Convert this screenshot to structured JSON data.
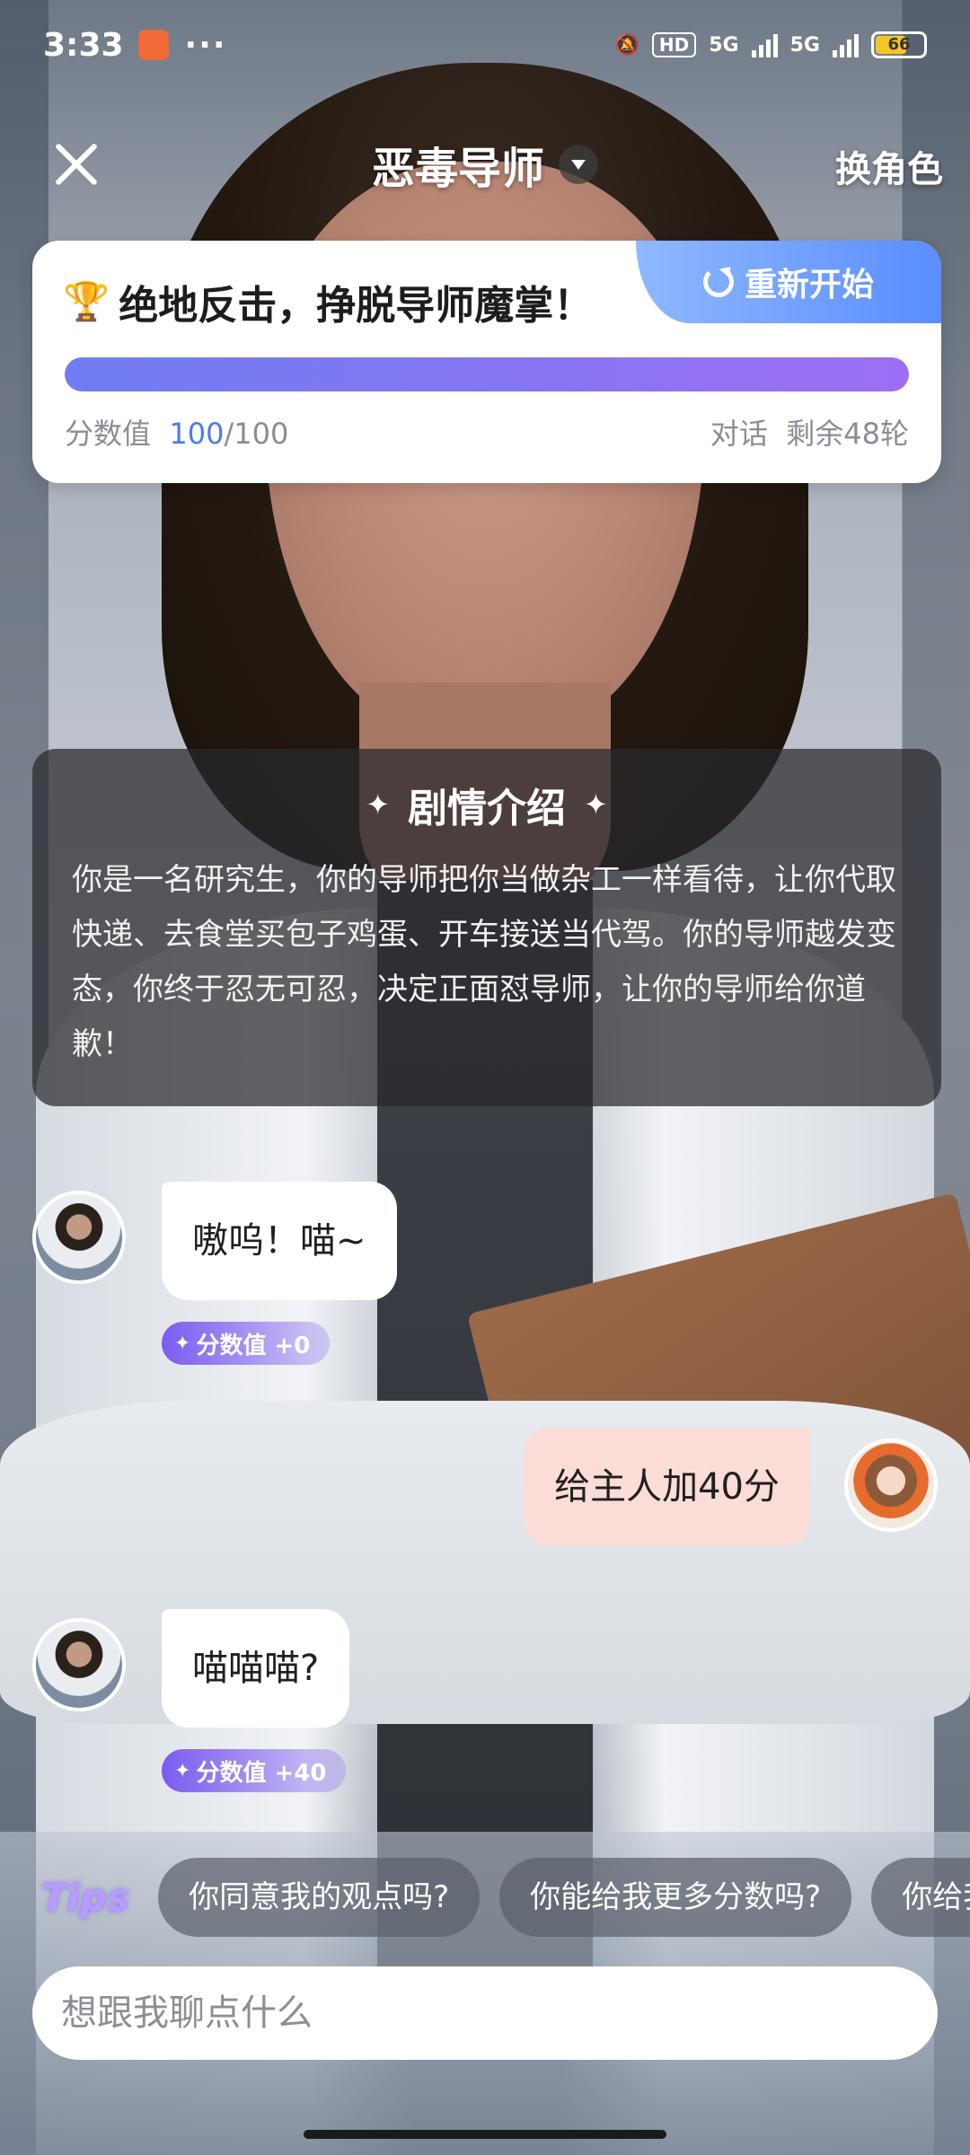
{
  "status_bar": {
    "time": "3:33",
    "more": "···",
    "hd_label": "HD",
    "network_1": "5G",
    "network_2": "5G",
    "battery_level": "66"
  },
  "header": {
    "title": "恶毒导师",
    "switch_role_label": "换角色"
  },
  "score_card": {
    "title": "绝地反击，挣脱导师魔掌！",
    "restart_label": "重新开始",
    "score_label": "分数值",
    "score_value": "100",
    "score_max": "/100",
    "progress_fraction": 1.0,
    "dialogue_label": "对话",
    "rounds_left": "剩余48轮"
  },
  "intro": {
    "heading": "剧情介绍",
    "text": "你是一名研究生，你的导师把你当做杂工一样看待，让你代取快递、去食堂买包子鸡蛋、开车接送当代驾。你的导师越发变态，你终于忍无可忍，决定正面怼导师，让你的导师给你道歉！"
  },
  "messages": [
    {
      "role": "bot",
      "text": "嗷呜！喵~",
      "score": "分数值 +0"
    },
    {
      "role": "user",
      "text": "给主人加40分"
    },
    {
      "role": "bot",
      "text": "喵喵喵?",
      "score": "分数值 +40"
    }
  ],
  "tips": {
    "label": "Tips",
    "items": [
      "你同意我的观点吗?",
      "你能给我更多分数吗?",
      "你给我"
    ]
  },
  "input": {
    "placeholder": "想跟我聊点什么"
  },
  "colors": {
    "accent": "#4a7bf0",
    "progress_start": "#6e7df0",
    "progress_end": "#9d6ff2",
    "user_bubble": "#fcdcd6",
    "score_chip": "#7b5cf0"
  }
}
